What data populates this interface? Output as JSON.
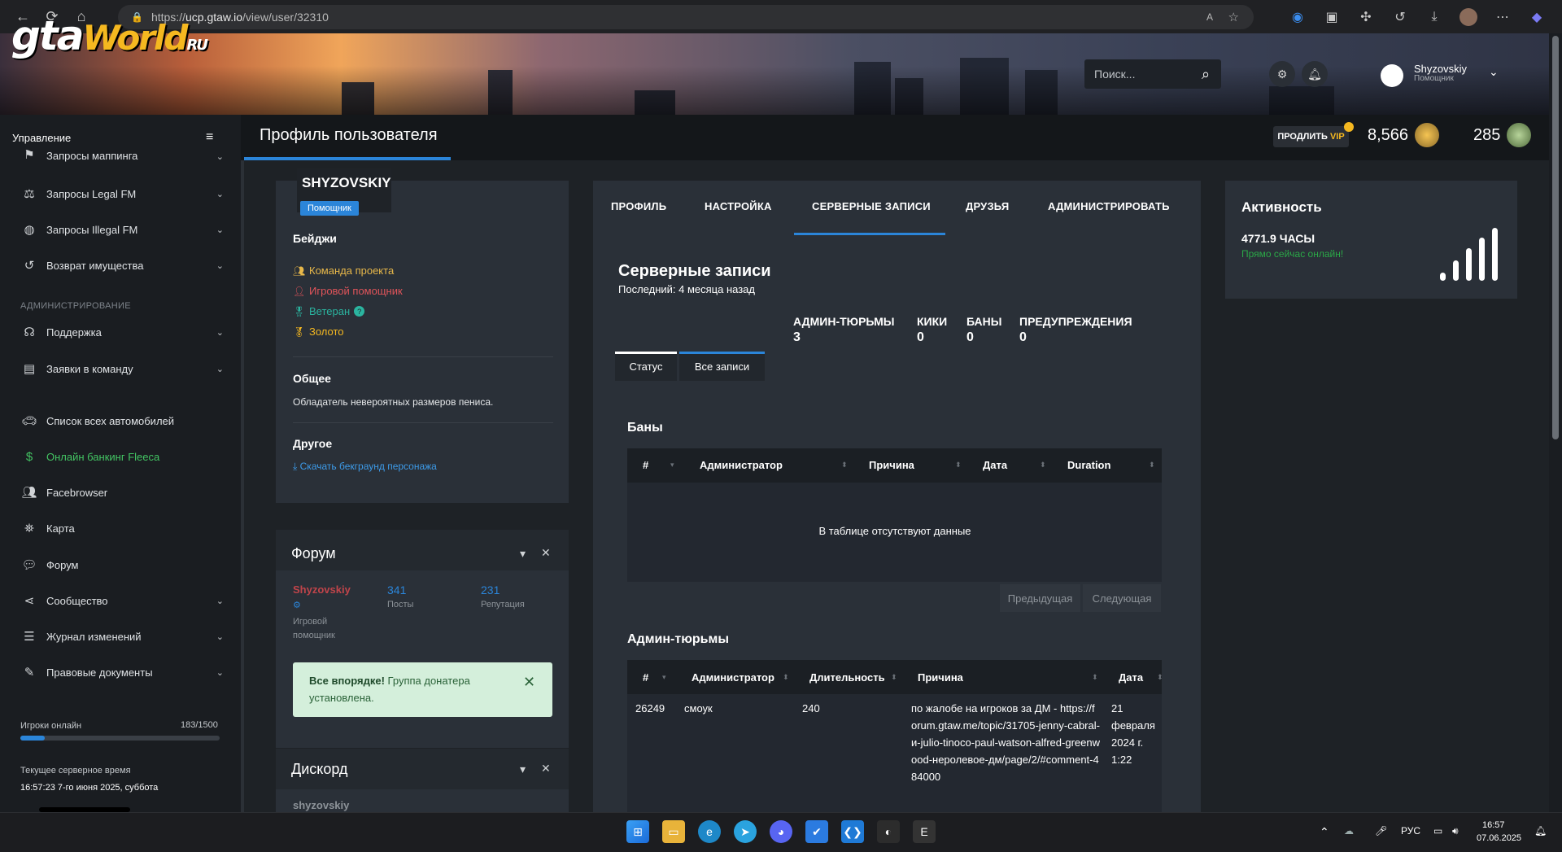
{
  "browser": {
    "url_prefix": "https://",
    "url_host": "ucp.gtaw.io",
    "url_path": "/view/user/32310"
  },
  "header": {
    "logo_gta": "gta",
    "logo_world": "World",
    "logo_ru": "RU",
    "search_placeholder": "Поиск...",
    "user_name": "Shyzovskiy",
    "user_role": "Помощник"
  },
  "topbar": {
    "sidebar_title": "Управление",
    "page_title": "Профиль пользователя",
    "vip_prefix": "ПРОДЛИТЬ",
    "vip_label": "VIP",
    "coins": "8,566",
    "tokens": "285"
  },
  "sidebar": {
    "items_top": [
      {
        "label": "Запросы маппинга",
        "icon": "map-icon"
      },
      {
        "label": "Запросы Legal FM",
        "icon": "scale-icon"
      },
      {
        "label": "Запросы Illegal FM",
        "icon": "mask-icon"
      },
      {
        "label": "Возврат имущества",
        "icon": "undo-icon"
      }
    ],
    "section_admin": "АДМИНИСТРИРОВАНИЕ",
    "items_admin": [
      {
        "label": "Поддержка",
        "icon": "headset-icon"
      },
      {
        "label": "Заявки в команду",
        "icon": "id-card-icon"
      }
    ],
    "items_bottom": [
      {
        "label": "Список всех автомобилей",
        "icon": "car-icon"
      },
      {
        "label": "Онлайн банкинг Fleeca",
        "icon": "money-icon"
      },
      {
        "label": "Facebrowser",
        "icon": "users-icon"
      },
      {
        "label": "Карта",
        "icon": "map-location-icon"
      },
      {
        "label": "Форум",
        "icon": "comments-icon"
      },
      {
        "label": "Сообщество",
        "icon": "share-icon"
      },
      {
        "label": "Журнал изменений",
        "icon": "list-icon"
      },
      {
        "label": "Правовые документы",
        "icon": "document-icon"
      }
    ],
    "online_label": "Игроки онлайн",
    "online_count": "183/1500",
    "online_fraction": 0.122,
    "time_label": "Текущее серверное время",
    "time_value": "16:57:23 7-го июня 2025, суббота"
  },
  "profile": {
    "name": "SHYZOVSKIY",
    "role": "Помощник",
    "badges_title": "Бейджи",
    "badges": [
      {
        "label": "Команда проекта",
        "color": "#e8b84a"
      },
      {
        "label": "Игровой помощник",
        "color": "#e0545a"
      },
      {
        "label": "Ветеран",
        "color": "#2bb5a0"
      },
      {
        "label": "Золото",
        "color": "#f5b820"
      }
    ],
    "general_title": "Общее",
    "general_text": "Обладатель невероятных размеров пениса.",
    "other_title": "Другое",
    "other_link": "Скачать бекграунд персонажа"
  },
  "forum": {
    "title": "Форум",
    "user": "Shyzovskiy",
    "user_role_line1": "Игровой",
    "user_role_line2": "помощник",
    "posts_value": "341",
    "posts_label": "Посты",
    "rep_value": "231",
    "rep_label": "Репутация",
    "alert_bold": "Все впорядке!",
    "alert_text": "Группа донатера установлена."
  },
  "discord": {
    "title": "Дискорд",
    "user": "shyzovskiy"
  },
  "records": {
    "tabs": [
      "ПРОФИЛЬ",
      "НАСТРОЙКА",
      "СЕРВЕРНЫЕ ЗАПИСИ",
      "ДРУЗЬЯ",
      "АДМИНИСТРИРОВАТЬ"
    ],
    "title": "Серверные записи",
    "last": "Последний: 4 месяца назад",
    "counters": [
      {
        "label": "АДМИН-ТЮРЬМЫ",
        "value": "3"
      },
      {
        "label": "КИКИ",
        "value": "0"
      },
      {
        "label": "БАНЫ",
        "value": "0"
      },
      {
        "label": "ПРЕДУПРЕЖДЕНИЯ",
        "value": "0"
      }
    ],
    "subtab_status": "Статус",
    "subtab_all": "Все записи",
    "bans_title": "Баны",
    "bans_columns": [
      "#",
      "Администратор",
      "Причина",
      "Дата",
      "Duration"
    ],
    "bans_empty": "В таблице отсутствуют данные",
    "prev": "Предыдущая",
    "next": "Следующая",
    "jails_title": "Админ-тюрьмы",
    "jails_columns": [
      "#",
      "Администратор",
      "Длительность",
      "Причина",
      "Дата"
    ],
    "jails_row": {
      "id": "26249",
      "admin": "смоук",
      "duration": "240",
      "reason": "по жалобе на игроков за ДМ - https://forum.gtaw.me/topic/31705-jenny-cabral-и-julio-tinoco-paul-watson-alfred-greenwood-неролевое-дм/page/2/#comment-484000",
      "date": "21 февраля 2024 г. 1:22"
    }
  },
  "activity": {
    "title": "Активность",
    "hours": "4771.9 ЧАСЫ",
    "online_now": "Прямо сейчас онлайн!"
  },
  "taskbar": {
    "lang": "РУС",
    "time": "16:57",
    "date": "07.06.2025"
  }
}
